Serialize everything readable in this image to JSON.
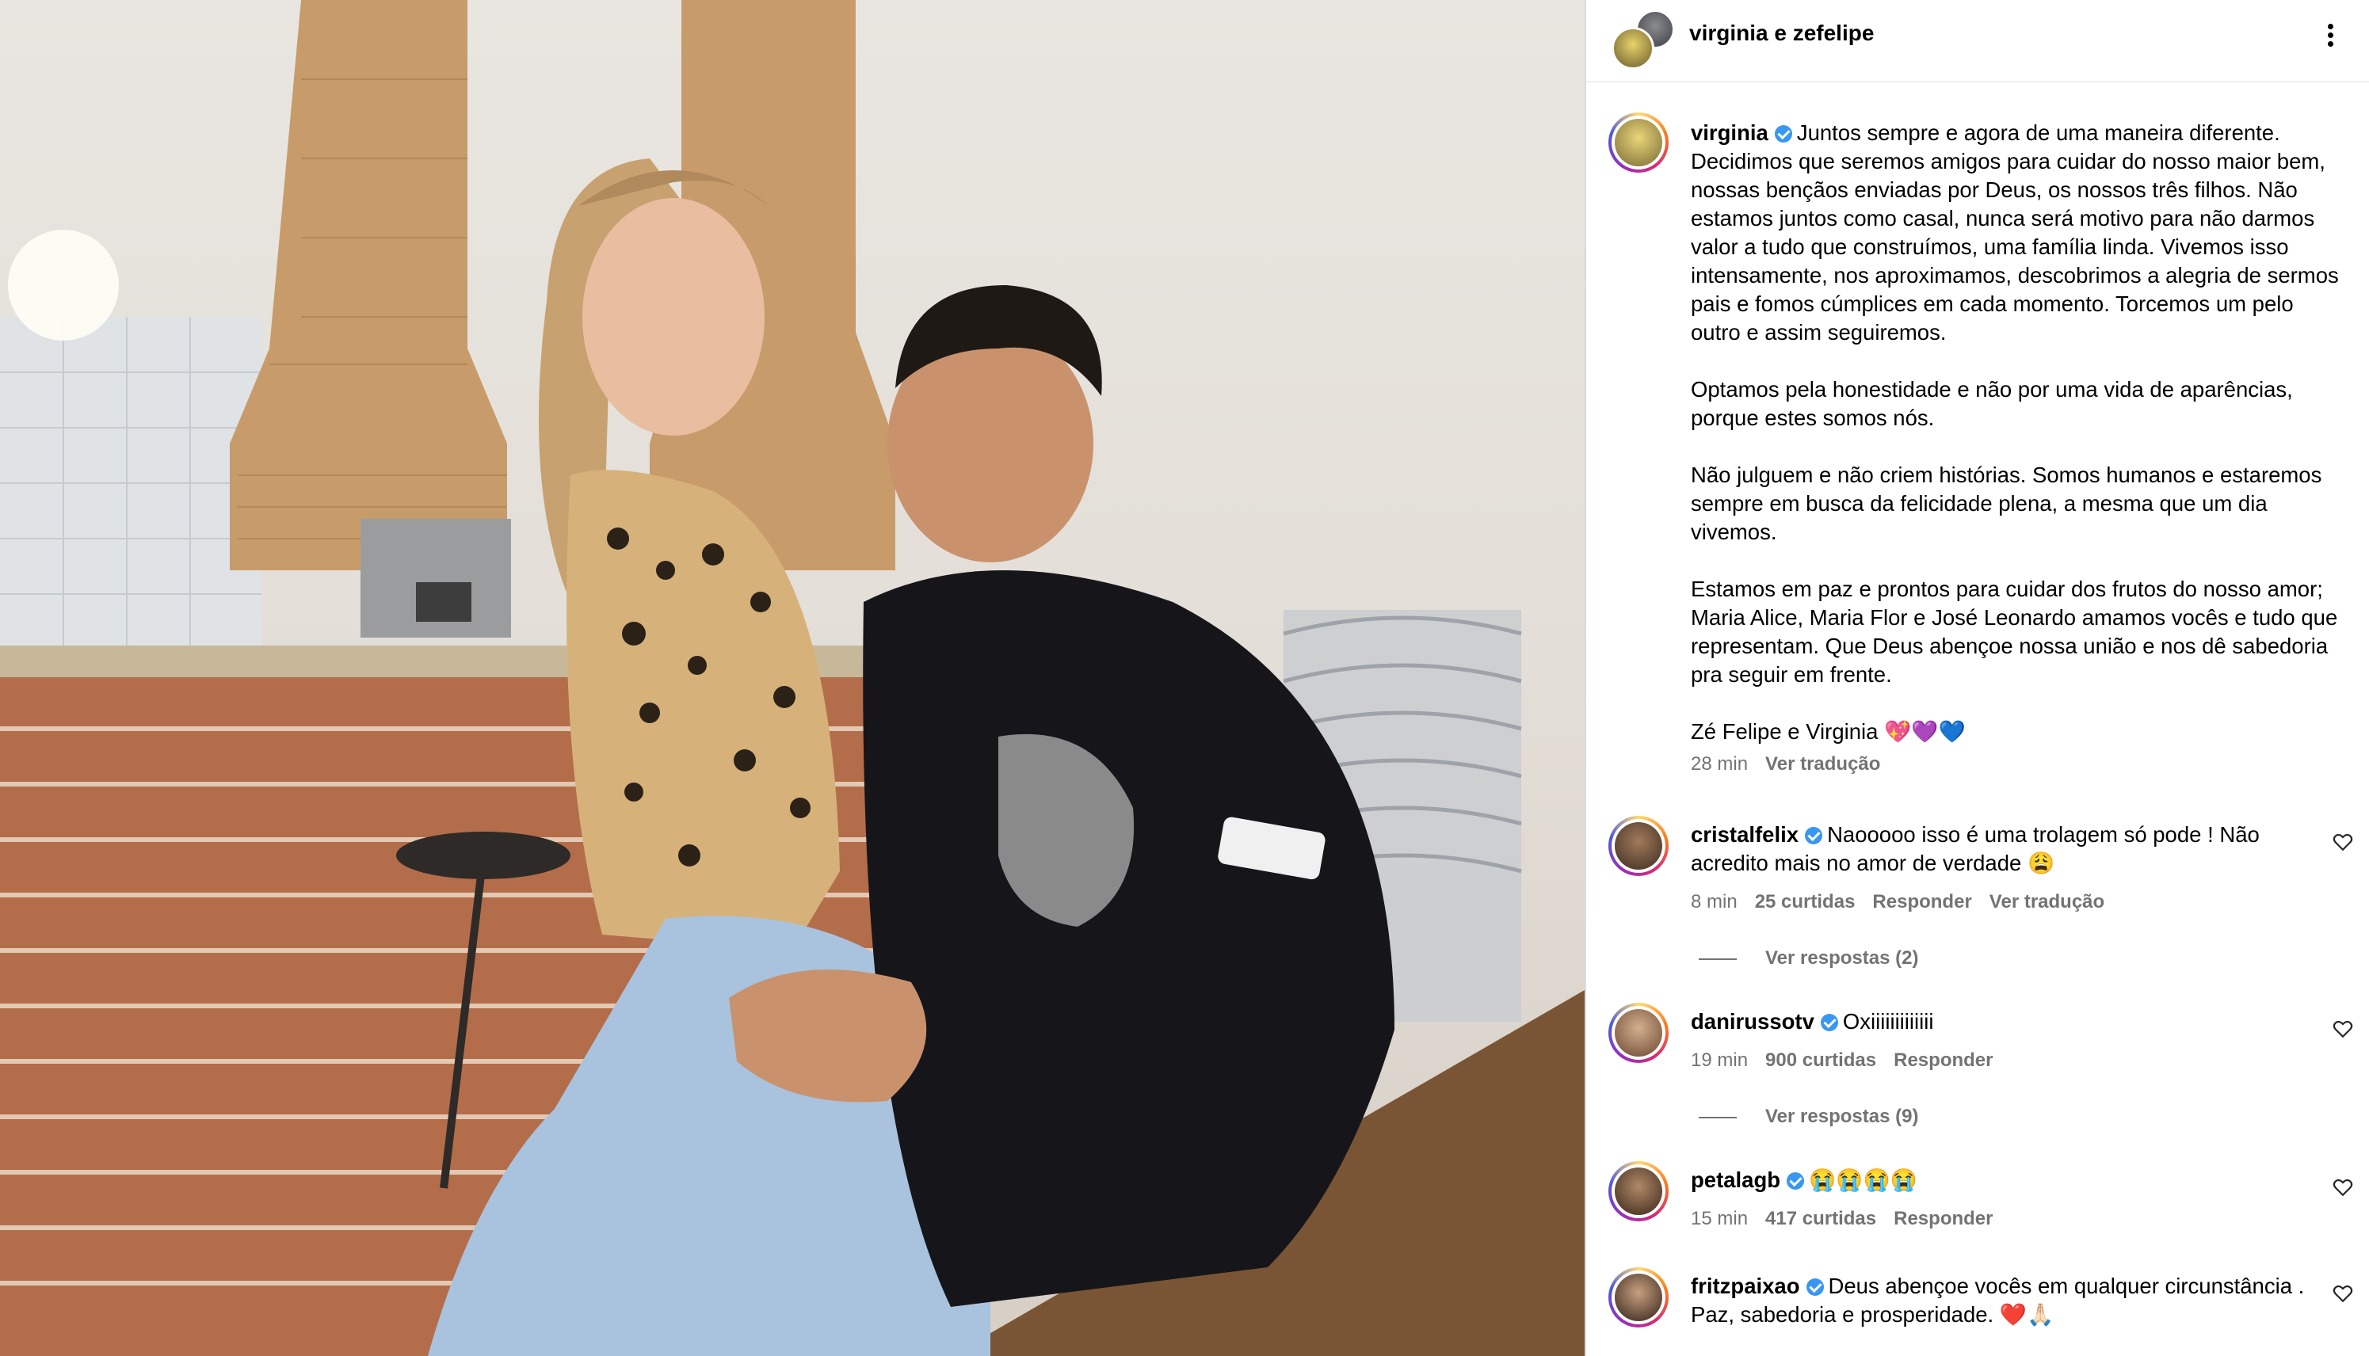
{
  "header": {
    "title": "virginia e zefelipe",
    "more_icon": "more-horizontal-icon"
  },
  "post": {
    "username": "virginia",
    "caption_paragraphs": [
      "Juntos sempre e agora de uma maneira diferente. Decidimos que seremos amigos para cuidar do nosso maior bem, nossas bençãos enviadas por Deus, os nossos três filhos. Não estamos juntos como casal, nunca será motivo para não darmos valor a tudo que construímos, uma família linda. Vivemos isso intensamente, nos aproximamos, descobrimos a alegria de sermos pais e fomos cúmplices em cada momento. Torcemos um pelo outro e assim seguiremos.",
      "Optamos pela honestidade e não por uma vida de aparências, porque estes somos nós.",
      "Não julguem e não criem histórias. Somos humanos e estaremos sempre em busca da felicidade plena, a mesma que um dia vivemos.",
      "Estamos em paz e prontos para cuidar dos frutos do nosso amor; Maria Alice, Maria Flor e José Leonardo amamos vocês e tudo que representam. Que Deus abençoe nossa união e nos dê sabedoria pra seguir em frente.",
      "Zé Felipe e Virginia 💖💜💙"
    ],
    "time": "28 min",
    "translate": "Ver tradução"
  },
  "comments": [
    {
      "username": "cristalfelix",
      "text": "Naooooo isso é uma trolagem só pode ! Não acredito mais no amor de verdade 😩",
      "time": "8 min",
      "likes": "25 curtidas",
      "reply": "Responder",
      "translate": "Ver tradução",
      "replies": "Ver respostas (2)"
    },
    {
      "username": "danirussotv",
      "text": "Oxiiiiiiiiiiiii",
      "time": "19 min",
      "likes": "900 curtidas",
      "reply": "Responder",
      "replies": "Ver respostas (9)"
    },
    {
      "username": "petalagb",
      "text": "😭😭😭😭",
      "time": "15 min",
      "likes": "417 curtidas",
      "reply": "Responder"
    },
    {
      "username": "fritzpaixao",
      "text": "Deus abençoe vocês em qualquer circunstância . Paz, sabedoria e prosperidade. ❤️🙏🏻"
    }
  ],
  "icons": {
    "verified": "verified-badge-icon",
    "like": "heart-outline-icon"
  },
  "colors": {
    "secondary_text": "#737373",
    "verified_blue": "#3897f0",
    "divider": "#efefef"
  }
}
